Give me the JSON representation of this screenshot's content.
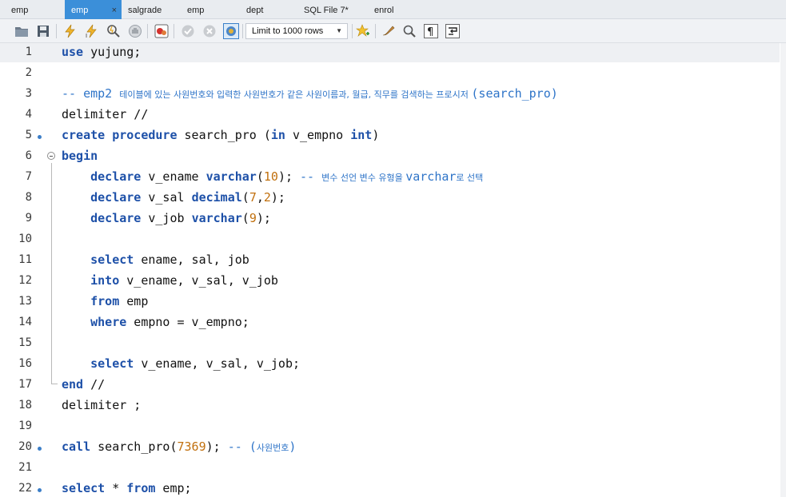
{
  "tabs": [
    {
      "label": "emp",
      "active": false
    },
    {
      "label": "emp",
      "active": true,
      "close": "×"
    },
    {
      "label": "salgrade",
      "active": false
    },
    {
      "label": "emp",
      "active": false
    },
    {
      "label": "dept",
      "active": false
    },
    {
      "label": "SQL File 7*",
      "active": false
    },
    {
      "label": "enrol",
      "active": false
    }
  ],
  "toolbar": {
    "limit_label": "Limit to 1000 rows",
    "icons": [
      "open-folder-icon",
      "save-icon",
      "execute-icon",
      "execute-current-icon",
      "explain-icon",
      "stop-icon",
      "toggle-error-icon",
      "commit-icon",
      "rollback-icon",
      "autocommit-icon",
      "beautify-star-icon",
      "brush-icon",
      "find-icon",
      "invisible-chars-icon",
      "wrap-icon"
    ]
  },
  "colors": {
    "keyword": "#1d50a8",
    "number": "#c1700e",
    "comment": "#2e74c8",
    "tab_active": "#3b8fd9"
  },
  "editor": {
    "lines": [
      {
        "n": "1",
        "dot": false,
        "tokens": [
          [
            "kw",
            "use"
          ],
          [
            "t",
            " yujung;"
          ]
        ]
      },
      {
        "n": "2",
        "dot": false,
        "tokens": []
      },
      {
        "n": "3",
        "dot": false,
        "tokens": [
          [
            "cm",
            "-- emp2 "
          ],
          [
            "cmk",
            "테이블에 있는 사원번호와 입력한 사원번호가 같은 사원이름과, 월급, 직무를 검색하는 프로시저 "
          ],
          [
            "cm",
            "(search_pro)"
          ]
        ]
      },
      {
        "n": "4",
        "dot": false,
        "tokens": [
          [
            "t",
            "delimiter //"
          ]
        ]
      },
      {
        "n": "5",
        "dot": true,
        "tokens": [
          [
            "kw",
            "create procedure"
          ],
          [
            "t",
            " search_pro ("
          ],
          [
            "kw",
            "in"
          ],
          [
            "t",
            " v_empno "
          ],
          [
            "kw",
            "int"
          ],
          [
            "t",
            ")"
          ]
        ]
      },
      {
        "n": "6",
        "dot": false,
        "tokens": [
          [
            "kw",
            "begin"
          ]
        ]
      },
      {
        "n": "7",
        "dot": false,
        "tokens": [
          [
            "t",
            "    "
          ],
          [
            "kw",
            "declare"
          ],
          [
            "t",
            " v_ename "
          ],
          [
            "kw",
            "varchar"
          ],
          [
            "t",
            "("
          ],
          [
            "num",
            "10"
          ],
          [
            "t",
            "); "
          ],
          [
            "cm",
            "-- "
          ],
          [
            "cmk",
            "변수 선언 변수 유형을 "
          ],
          [
            "cm",
            "varchar"
          ],
          [
            "cmk",
            "로 선택"
          ]
        ]
      },
      {
        "n": "8",
        "dot": false,
        "tokens": [
          [
            "t",
            "    "
          ],
          [
            "kw",
            "declare"
          ],
          [
            "t",
            " v_sal "
          ],
          [
            "kw",
            "decimal"
          ],
          [
            "t",
            "("
          ],
          [
            "num",
            "7"
          ],
          [
            "t",
            ","
          ],
          [
            "num",
            "2"
          ],
          [
            "t",
            ");"
          ]
        ]
      },
      {
        "n": "9",
        "dot": false,
        "tokens": [
          [
            "t",
            "    "
          ],
          [
            "kw",
            "declare"
          ],
          [
            "t",
            " v_job "
          ],
          [
            "kw",
            "varchar"
          ],
          [
            "t",
            "("
          ],
          [
            "num",
            "9"
          ],
          [
            "t",
            ");"
          ]
        ]
      },
      {
        "n": "10",
        "dot": false,
        "tokens": []
      },
      {
        "n": "11",
        "dot": false,
        "tokens": [
          [
            "t",
            "    "
          ],
          [
            "kw",
            "select"
          ],
          [
            "t",
            " ename, sal, job"
          ]
        ]
      },
      {
        "n": "12",
        "dot": false,
        "tokens": [
          [
            "t",
            "    "
          ],
          [
            "kw",
            "into"
          ],
          [
            "t",
            " v_ename, v_sal, v_job"
          ]
        ]
      },
      {
        "n": "13",
        "dot": false,
        "tokens": [
          [
            "t",
            "    "
          ],
          [
            "kw",
            "from"
          ],
          [
            "t",
            " emp"
          ]
        ]
      },
      {
        "n": "14",
        "dot": false,
        "tokens": [
          [
            "t",
            "    "
          ],
          [
            "kw",
            "where"
          ],
          [
            "t",
            " empno = v_empno;"
          ]
        ]
      },
      {
        "n": "15",
        "dot": false,
        "tokens": []
      },
      {
        "n": "16",
        "dot": false,
        "tokens": [
          [
            "t",
            "    "
          ],
          [
            "kw",
            "select"
          ],
          [
            "t",
            " v_ename, v_sal, v_job;"
          ]
        ]
      },
      {
        "n": "17",
        "dot": false,
        "tokens": [
          [
            "kw",
            "end"
          ],
          [
            "t",
            " //"
          ]
        ]
      },
      {
        "n": "18",
        "dot": false,
        "tokens": [
          [
            "t",
            "delimiter ;"
          ]
        ]
      },
      {
        "n": "19",
        "dot": false,
        "tokens": []
      },
      {
        "n": "20",
        "dot": true,
        "tokens": [
          [
            "kw",
            "call"
          ],
          [
            "t",
            " search_pro("
          ],
          [
            "num",
            "7369"
          ],
          [
            "t",
            "); "
          ],
          [
            "cm",
            "-- ("
          ],
          [
            "cmk",
            "사원번호"
          ],
          [
            "cm",
            ")"
          ]
        ]
      },
      {
        "n": "21",
        "dot": false,
        "tokens": []
      },
      {
        "n": "22",
        "dot": true,
        "tokens": [
          [
            "kw",
            "select"
          ],
          [
            "t",
            " * "
          ],
          [
            "kw",
            "from"
          ],
          [
            "t",
            " emp;"
          ]
        ]
      }
    ]
  }
}
